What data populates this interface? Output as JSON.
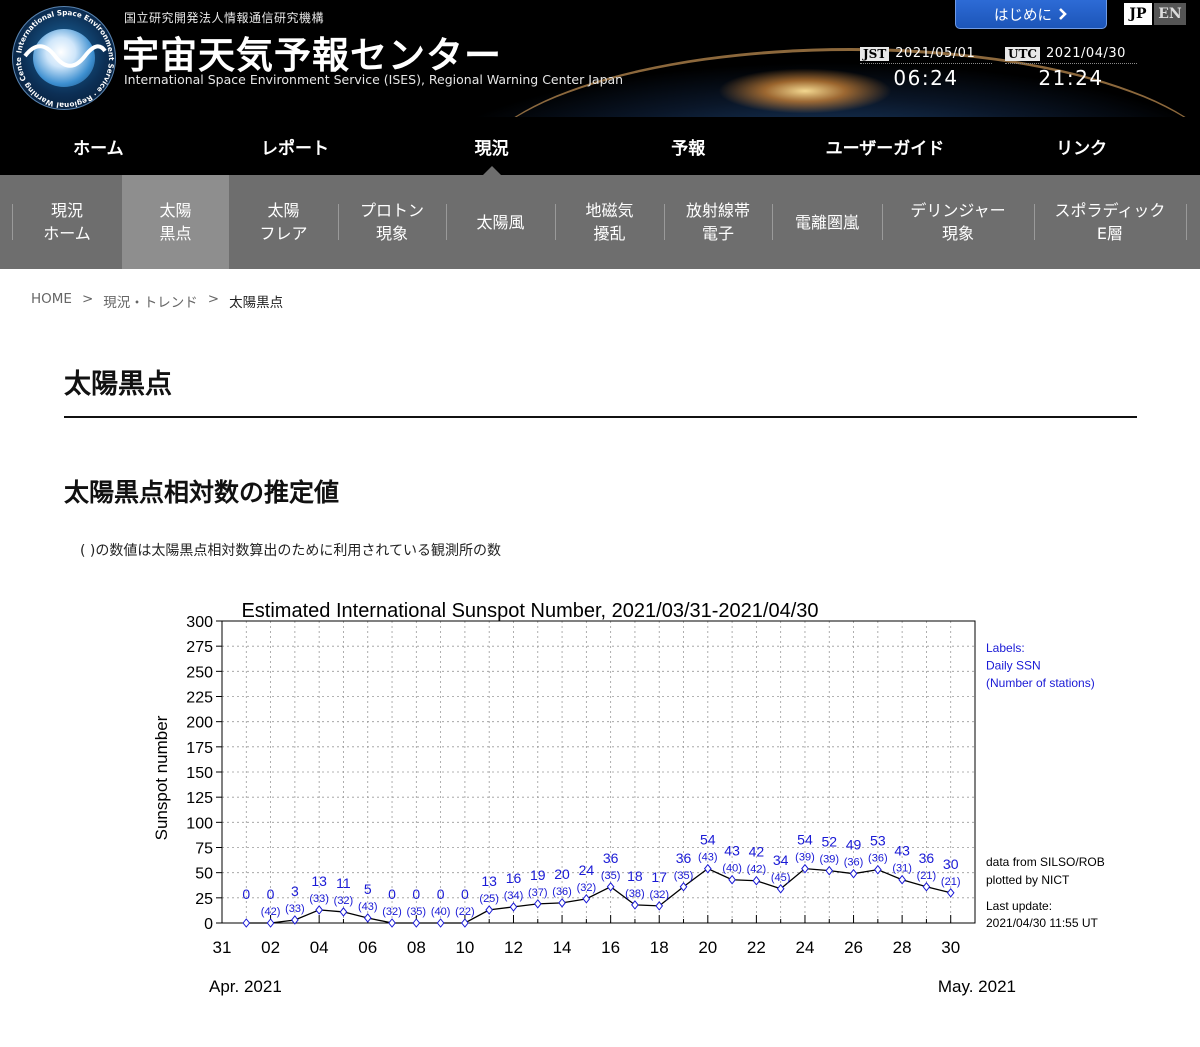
{
  "header": {
    "org_name": "国立研究開発法人情報通信研究機構",
    "title": "宇宙天気予報センター",
    "subtitle": "International Space Environment Service (ISES), Regional Warning Center Japan",
    "logo_ring_text": "International Space Environment Service · Regional Warning Center Japan",
    "start_button": "はじめに",
    "start_icon": "chevron-right-icon",
    "lang_jp": "JP",
    "lang_en": "EN",
    "jst_label": "JST",
    "jst_date": "2021/05/01",
    "jst_time": "06:24",
    "utc_label": "UTC",
    "utc_date": "2021/04/30",
    "utc_time": "21:24"
  },
  "main_nav": [
    {
      "label": "ホーム"
    },
    {
      "label": "レポート"
    },
    {
      "label": "現況"
    },
    {
      "label": "予報"
    },
    {
      "label": "ユーザーガイド"
    },
    {
      "label": "リンク"
    }
  ],
  "sub_nav": [
    {
      "label": "現況\nホーム"
    },
    {
      "label": "太陽\n黒点"
    },
    {
      "label": "太陽\nフレア"
    },
    {
      "label": "プロトン\n現象"
    },
    {
      "label": "太陽風"
    },
    {
      "label": "地磁気\n擾乱"
    },
    {
      "label": "放射線帯\n電子"
    },
    {
      "label": "電離圏嵐"
    },
    {
      "label": "デリンジャー\n現象"
    },
    {
      "label": "スポラディック\nE層"
    }
  ],
  "breadcrumb": [
    "HOME",
    ">",
    "現況・トレンド",
    ">",
    "太陽黒点"
  ],
  "page_title": "太陽黒点",
  "section_title": "太陽黒点相対数の推定値",
  "note": "( )の数値は太陽黒点相対数算出のために利用されている観測所の数",
  "colors": {
    "label_blue": "#1a1ad6",
    "nav_black": "#000000",
    "subnav_gray": "#6e6e6e",
    "subnav_active": "#8e8e8e"
  },
  "chart_data": {
    "type": "line",
    "title": "Estimated International Sunspot Number, 2021/03/31-2021/04/30",
    "ylabel": "Sunspot number",
    "ylim": [
      0,
      300
    ],
    "yticks": [
      0,
      25,
      50,
      75,
      100,
      125,
      150,
      175,
      200,
      225,
      250,
      275,
      300
    ],
    "x_tick_labels": [
      "31",
      "02",
      "04",
      "06",
      "08",
      "10",
      "12",
      "14",
      "16",
      "18",
      "20",
      "22",
      "24",
      "26",
      "28",
      "30"
    ],
    "month_left": "Apr. 2021",
    "month_right": "May. 2021",
    "grid": true,
    "days": [
      1,
      2,
      3,
      4,
      5,
      6,
      7,
      8,
      9,
      10,
      11,
      12,
      13,
      14,
      15,
      16,
      17,
      18,
      19,
      20,
      21,
      22,
      23,
      24,
      25,
      26,
      27,
      28,
      29,
      30
    ],
    "values": [
      0,
      0,
      3,
      13,
      11,
      5,
      0,
      0,
      0,
      0,
      13,
      16,
      19,
      20,
      24,
      36,
      18,
      17,
      36,
      54,
      43,
      42,
      34,
      54,
      52,
      49,
      53,
      43,
      36,
      30
    ],
    "stations": [
      null,
      42,
      33,
      33,
      32,
      43,
      32,
      35,
      40,
      22,
      25,
      34,
      37,
      36,
      32,
      35,
      38,
      32,
      35,
      43,
      40,
      42,
      45,
      39,
      39,
      36,
      36,
      31,
      21,
      21
    ],
    "legend_lines": [
      "Labels:",
      "Daily SSN",
      "(Number of stations)"
    ],
    "source_lines": [
      "data from SILSO/ROB",
      "plotted by NICT"
    ],
    "update_lines": [
      "Last update:",
      "2021/04/30 11:55 UT"
    ]
  }
}
